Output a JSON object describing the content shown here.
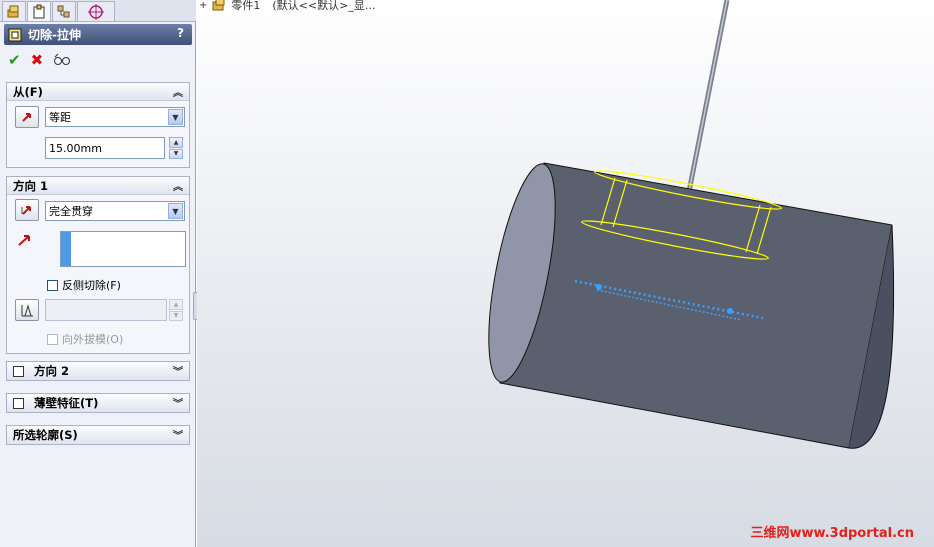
{
  "feature": {
    "title": "切除-拉伸",
    "help": "?"
  },
  "from": {
    "header": "从(F)",
    "condition": "等距",
    "offset_value": "15.00mm"
  },
  "direction1": {
    "header": "方向 1",
    "end_condition": "完全贯穿",
    "flip_side_label": "反侧切除(F)",
    "draft_outward_label": "向外拔模(O)"
  },
  "direction2": {
    "header": "方向 2"
  },
  "thin_feature": {
    "header": "薄壁特征(T)"
  },
  "selected_contours": {
    "header": "所选轮廓(S)"
  },
  "tree": {
    "part_label": "零件1",
    "config_label": "(默认<<默认>_显..."
  },
  "watermark": "三维网www.3dportal.cn",
  "colors": {
    "header_bg": "#4a5b84",
    "model_body": "#5a5f70",
    "model_face": "#8a8fa4",
    "sketch_highlight": "#ffff00",
    "watermark": "#e0221b"
  }
}
